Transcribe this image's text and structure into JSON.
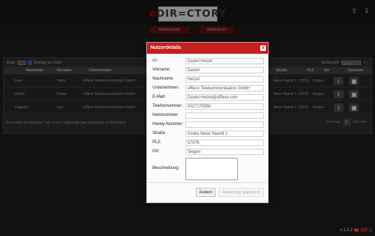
{
  "app": {
    "logo_prefix": "e",
    "logo_rest": "DIR=CTORY",
    "nav": {
      "home": "HAUSLEGEN",
      "overview": "ÜBERSICHT"
    },
    "icons": [
      "upload-icon",
      "download-icon"
    ]
  },
  "table": {
    "show_prefix": "Zeige",
    "show_suffix": "Einträge pro Seite",
    "search_label": "Suchbegriff",
    "search_placeholder": "Name",
    "columns_left": [
      "Nachname",
      "Vorname",
      "Unternehmen"
    ],
    "columns_right": [
      "Straße",
      "PLZ",
      "Ort",
      "Optionen"
    ],
    "rows": [
      {
        "nachname": "Friez",
        "vorname": "Timm",
        "unternehmen": "efflexx Telekommunikation GmbH",
        "strasse": "Neue Haardt 1",
        "plz": "57076",
        "ort": "Siegen"
      },
      {
        "nachname": "Hetzel",
        "vorname": "Daniel",
        "unternehmen": "efflexx Telekommunikation GmbH",
        "strasse": "Neue Haardt 1",
        "plz": "57076",
        "ort": "Siegen"
      },
      {
        "nachname": "Wiggelin",
        "vorname": "Lars",
        "unternehmen": "efflexx Telekommunikation GmbH",
        "strasse": "Neue Haardt 1",
        "plz": "57076",
        "ort": "Siegen"
      }
    ],
    "info_glyph": "i",
    "delete_glyph": "▣",
    "footer": "Es werden die Einträge 1 bis 3 von 3 angezeigt (aus insgesamt 14 Einträgen)",
    "pager_prev": "Vorherige",
    "pager_page": "1",
    "pager_next": "Nächste"
  },
  "version": {
    "text": "v.1.2.2",
    "by": "by",
    "brand": "eff-x"
  },
  "modal": {
    "title": "Nutzerdetails",
    "close_glyph": "x",
    "fields": [
      {
        "label": "cn:",
        "value": "Daniel Hetzel"
      },
      {
        "label": "Vorname:",
        "value": "Daniel"
      },
      {
        "label": "Nachname:",
        "value": "Hetzel"
      },
      {
        "label": "Unternehmen:",
        "value": "efflexx Telekommunikation GmbH"
      },
      {
        "label": "E-Mail:",
        "value": "Daniel.Hetzel@efflexx.com"
      },
      {
        "label": "Telefonnummer:",
        "value": "0027170950"
      },
      {
        "label": "Heimnummer:",
        "value": ""
      },
      {
        "label": "Handy-Nummer:",
        "value": ""
      },
      {
        "label": "Straße:",
        "value": "Grube Neue Haardt 1"
      },
      {
        "label": "PLZ:",
        "value": "57076"
      },
      {
        "label": "Ort:",
        "value": "Siegen"
      }
    ],
    "description_label": "Beschreibung:",
    "description_value": "",
    "buttons": {
      "change": "Ändern",
      "save": "Änderung speichern"
    }
  },
  "colors": {
    "accent": "#c61f1f",
    "background": "#1b1b1b"
  }
}
